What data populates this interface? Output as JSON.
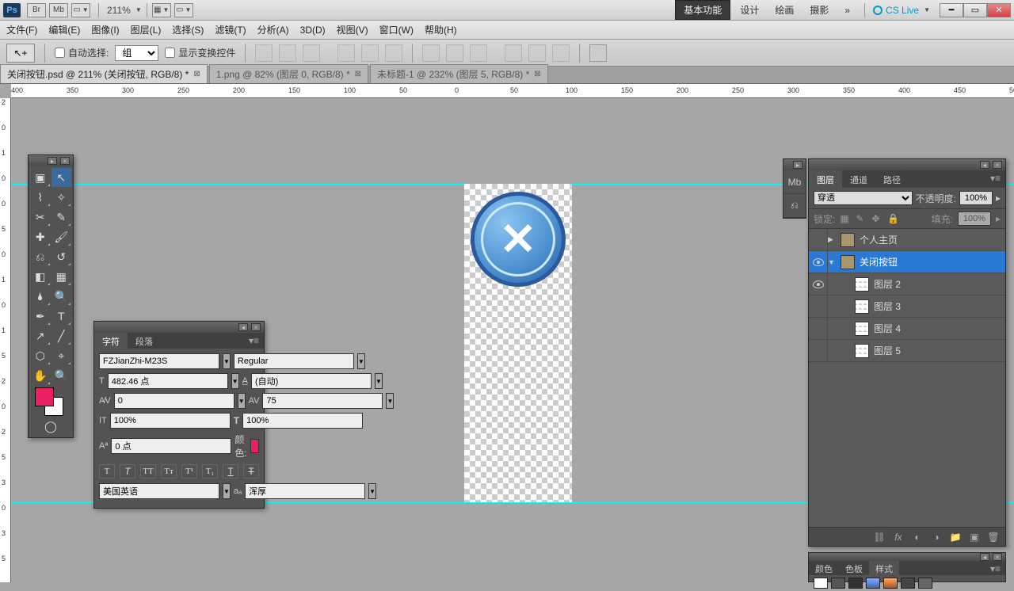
{
  "topbar": {
    "zoom": "211%"
  },
  "workspace": {
    "active": "基本功能",
    "items": [
      "设计",
      "绘画",
      "摄影"
    ],
    "more": "»",
    "cslive": "CS Live"
  },
  "menu": [
    "文件(F)",
    "编辑(E)",
    "图像(I)",
    "图层(L)",
    "选择(S)",
    "滤镜(T)",
    "分析(A)",
    "3D(D)",
    "视图(V)",
    "窗口(W)",
    "帮助(H)"
  ],
  "options": {
    "auto_select": "自动选择:",
    "group": "组",
    "show_transform": "显示变换控件"
  },
  "tabs": [
    {
      "label": "关闭按钮.psd @ 211% (关闭按钮, RGB/8) *",
      "active": true
    },
    {
      "label": "1.png @ 82% (图层 0, RGB/8) *",
      "active": false
    },
    {
      "label": "未标题-1 @ 232% (图层 5, RGB/8) *",
      "active": false
    }
  ],
  "ruler_h": [
    "400",
    "350",
    "300",
    "250",
    "200",
    "150",
    "100",
    "50",
    "0",
    "50",
    "100",
    "150",
    "200",
    "250",
    "300",
    "350",
    "400",
    "450",
    "50"
  ],
  "ruler_v": [
    "2",
    "0",
    "1",
    "0",
    "0",
    "5",
    "0",
    "1",
    "0",
    "1",
    "5",
    "2",
    "0",
    "2",
    "5",
    "3",
    "0",
    "3",
    "5"
  ],
  "char": {
    "tabs": [
      "字符",
      "段落"
    ],
    "font": "FZJianZhi-M23S",
    "style": "Regular",
    "size": "482.46 点",
    "leading": "(自动)",
    "kern": "0",
    "track": "75",
    "vscale": "100%",
    "hscale": "100%",
    "baseline": "0 点",
    "color_label": "颜色:",
    "lang": "美国英语",
    "aa": "浑厚"
  },
  "layers": {
    "tabs": [
      "图层",
      "通道",
      "路径"
    ],
    "blend": "穿透",
    "opacity_label": "不透明度:",
    "opacity": "100%",
    "lock_label": "锁定:",
    "fill_label": "填充:",
    "fill": "100%",
    "items": [
      {
        "name": "个人主页",
        "type": "folder",
        "open": false,
        "vis": false,
        "sel": false,
        "indent": 0
      },
      {
        "name": "关闭按钮",
        "type": "folder",
        "open": true,
        "vis": true,
        "sel": true,
        "indent": 0
      },
      {
        "name": "图层 2",
        "type": "layer",
        "vis": true,
        "sel": false,
        "indent": 1
      },
      {
        "name": "图层 3",
        "type": "layer",
        "vis": false,
        "sel": false,
        "indent": 1
      },
      {
        "name": "图层 4",
        "type": "layer",
        "vis": false,
        "sel": false,
        "indent": 1
      },
      {
        "name": "图层 5",
        "type": "layer",
        "vis": false,
        "sel": false,
        "indent": 1
      }
    ]
  },
  "color_strip": {
    "tabs": [
      "颜色",
      "色板",
      "样式"
    ]
  }
}
